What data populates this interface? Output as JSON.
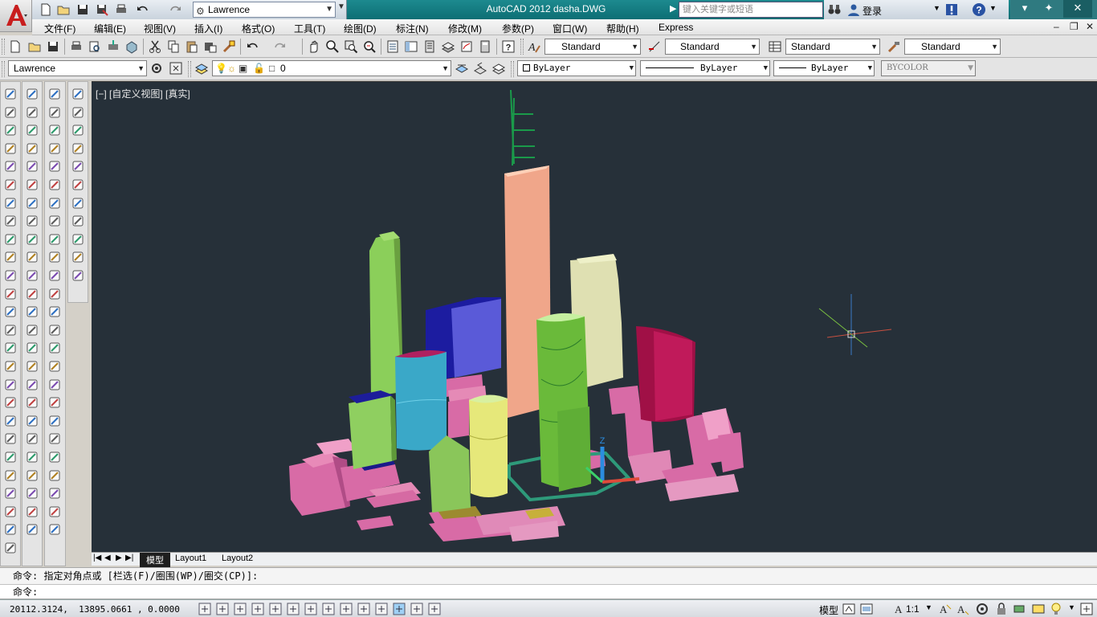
{
  "app": {
    "title": "AutoCAD 2012    dasha.DWG",
    "workspace": "Lawrence"
  },
  "search": {
    "placeholder": "键入关键字或短语"
  },
  "login": {
    "label": "登录"
  },
  "menu": {
    "items": [
      "文件(F)",
      "编辑(E)",
      "视图(V)",
      "插入(I)",
      "格式(O)",
      "工具(T)",
      "绘图(D)",
      "标注(N)",
      "修改(M)",
      "参数(P)",
      "窗口(W)",
      "帮助(H)",
      "Express"
    ]
  },
  "styles_toolbar": {
    "text_style": "Standard",
    "dim_style": "Standard",
    "table_style": "Standard",
    "mleader_style": "Standard"
  },
  "layers_toolbar": {
    "workspace": "Lawrence",
    "layer": "0",
    "color": "ByLayer",
    "linetype": "ByLayer",
    "lineweight": "ByLayer",
    "plotstyle": "BYCOLOR"
  },
  "viewport": {
    "label": "[−] [自定义视图] [真实]"
  },
  "tabs": [
    "模型",
    "Layout1",
    "Layout2"
  ],
  "command": {
    "history": "命令: 指定对角点或 [栏选(F)/圈围(WP)/圈交(CP)]:",
    "prompt": "命令:"
  },
  "status": {
    "coords": "20112.3124,  13895.0661 , 0.0000",
    "model_label": "模型",
    "scale": "1:1"
  },
  "colors": {
    "titlebar": "#0d6e74",
    "viewport_bg": "#263039",
    "ucs_z": "#2b8ce0",
    "ucs_x": "#e04a3a",
    "ucs_y": "#3bd06a"
  }
}
